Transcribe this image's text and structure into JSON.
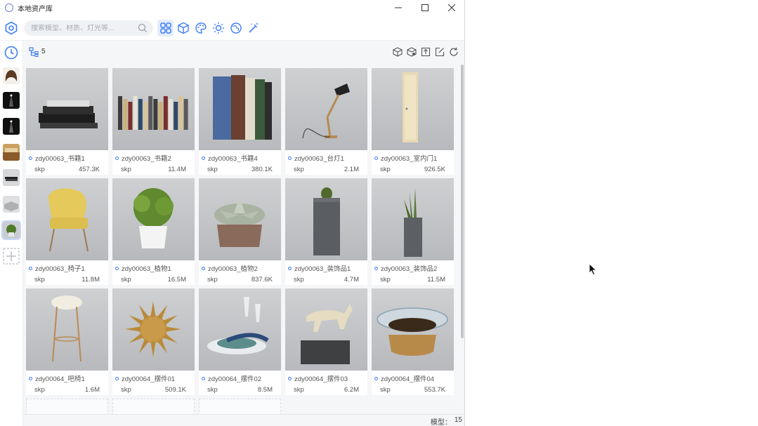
{
  "window": {
    "title": "本地资产库",
    "controls": {
      "minimize": "—",
      "maximize": "☐",
      "close": "✕"
    }
  },
  "toolbar": {
    "search_placeholder": "搜索模型、材质、灯光等...",
    "categories": [
      "model-group",
      "cube",
      "material",
      "light",
      "environment",
      "magic"
    ],
    "active_category": "model-group",
    "accent_color": "#3d7df2"
  },
  "sidebar": {
    "items": [
      "clock-icon",
      "hair",
      "light-1",
      "light-2",
      "room",
      "books",
      "slab",
      "plant",
      "add"
    ]
  },
  "subbar": {
    "count": "5",
    "actions": [
      "export-cube-icon",
      "import-cube-icon",
      "upload-icon",
      "edit-icon",
      "refresh-icon"
    ]
  },
  "assets": [
    {
      "name": "zdy00063_书籍1",
      "type": "skp",
      "size": "457.3K"
    },
    {
      "name": "zdy00063_书籍2",
      "type": "skp",
      "size": "11.4M"
    },
    {
      "name": "zdy00063_书籍4",
      "type": "skp",
      "size": "380.1K"
    },
    {
      "name": "zdy00063_台灯1",
      "type": "skp",
      "size": "2.1M"
    },
    {
      "name": "zdy00063_室内门1",
      "type": "skp",
      "size": "926.5K"
    },
    {
      "name": "zdy00063_椅子1",
      "type": "skp",
      "size": "11.8M"
    },
    {
      "name": "zdy00063_植物1",
      "type": "skp",
      "size": "16.5M"
    },
    {
      "name": "zdy00063_植物2",
      "type": "skp",
      "size": "837.6K"
    },
    {
      "name": "zdy00063_装饰品1",
      "type": "skp",
      "size": "4.7M"
    },
    {
      "name": "zdy00063_装饰品2",
      "type": "skp",
      "size": "11.5M"
    },
    {
      "name": "zdy00064_吧椅1",
      "type": "skp",
      "size": "1.6M"
    },
    {
      "name": "zdy00064_摆件01",
      "type": "skp",
      "size": "509.1K"
    },
    {
      "name": "zdy00064_摆件02",
      "type": "skp",
      "size": "8.5M"
    },
    {
      "name": "zdy00064_摆件03",
      "type": "skp",
      "size": "6.2M"
    },
    {
      "name": "zdy00064_摆件04",
      "type": "skp",
      "size": "553.7K"
    }
  ],
  "status": {
    "label": "模型：",
    "count": "15"
  }
}
